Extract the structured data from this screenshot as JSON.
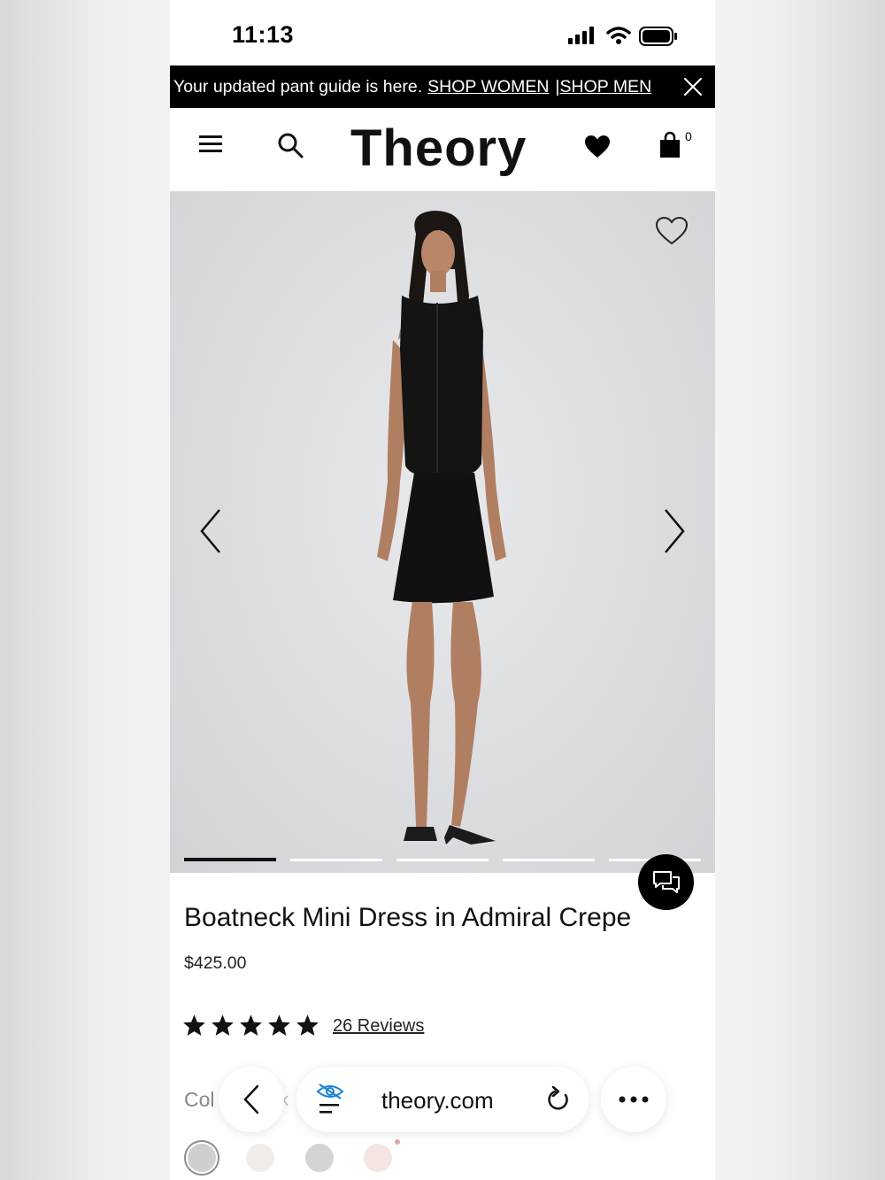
{
  "status_bar": {
    "time": "11:13"
  },
  "promo": {
    "text": "Your updated pant guide is here.",
    "link_women": "SHOP WOMEN",
    "separator": "|",
    "link_men": "SHOP MEN"
  },
  "header": {
    "brand": "Theory",
    "bag_count": "0"
  },
  "gallery": {
    "slide_count": 5,
    "active_index": 0
  },
  "product": {
    "title": "Boatneck Mini Dress in Admiral Crepe",
    "price": "$425.00",
    "rating": 5,
    "reviews_label": "26 Reviews",
    "color_label": "Col",
    "color_value": "k",
    "swatch_colors": [
      "#cfcfcf",
      "#f2ece8",
      "#d4d4d8",
      "#f4e4e2"
    ]
  },
  "browser": {
    "url": "theory.com"
  },
  "colors": {
    "banner_bg": "#000000",
    "accent": "#111111",
    "eye_icon": "#1a7fd6"
  }
}
